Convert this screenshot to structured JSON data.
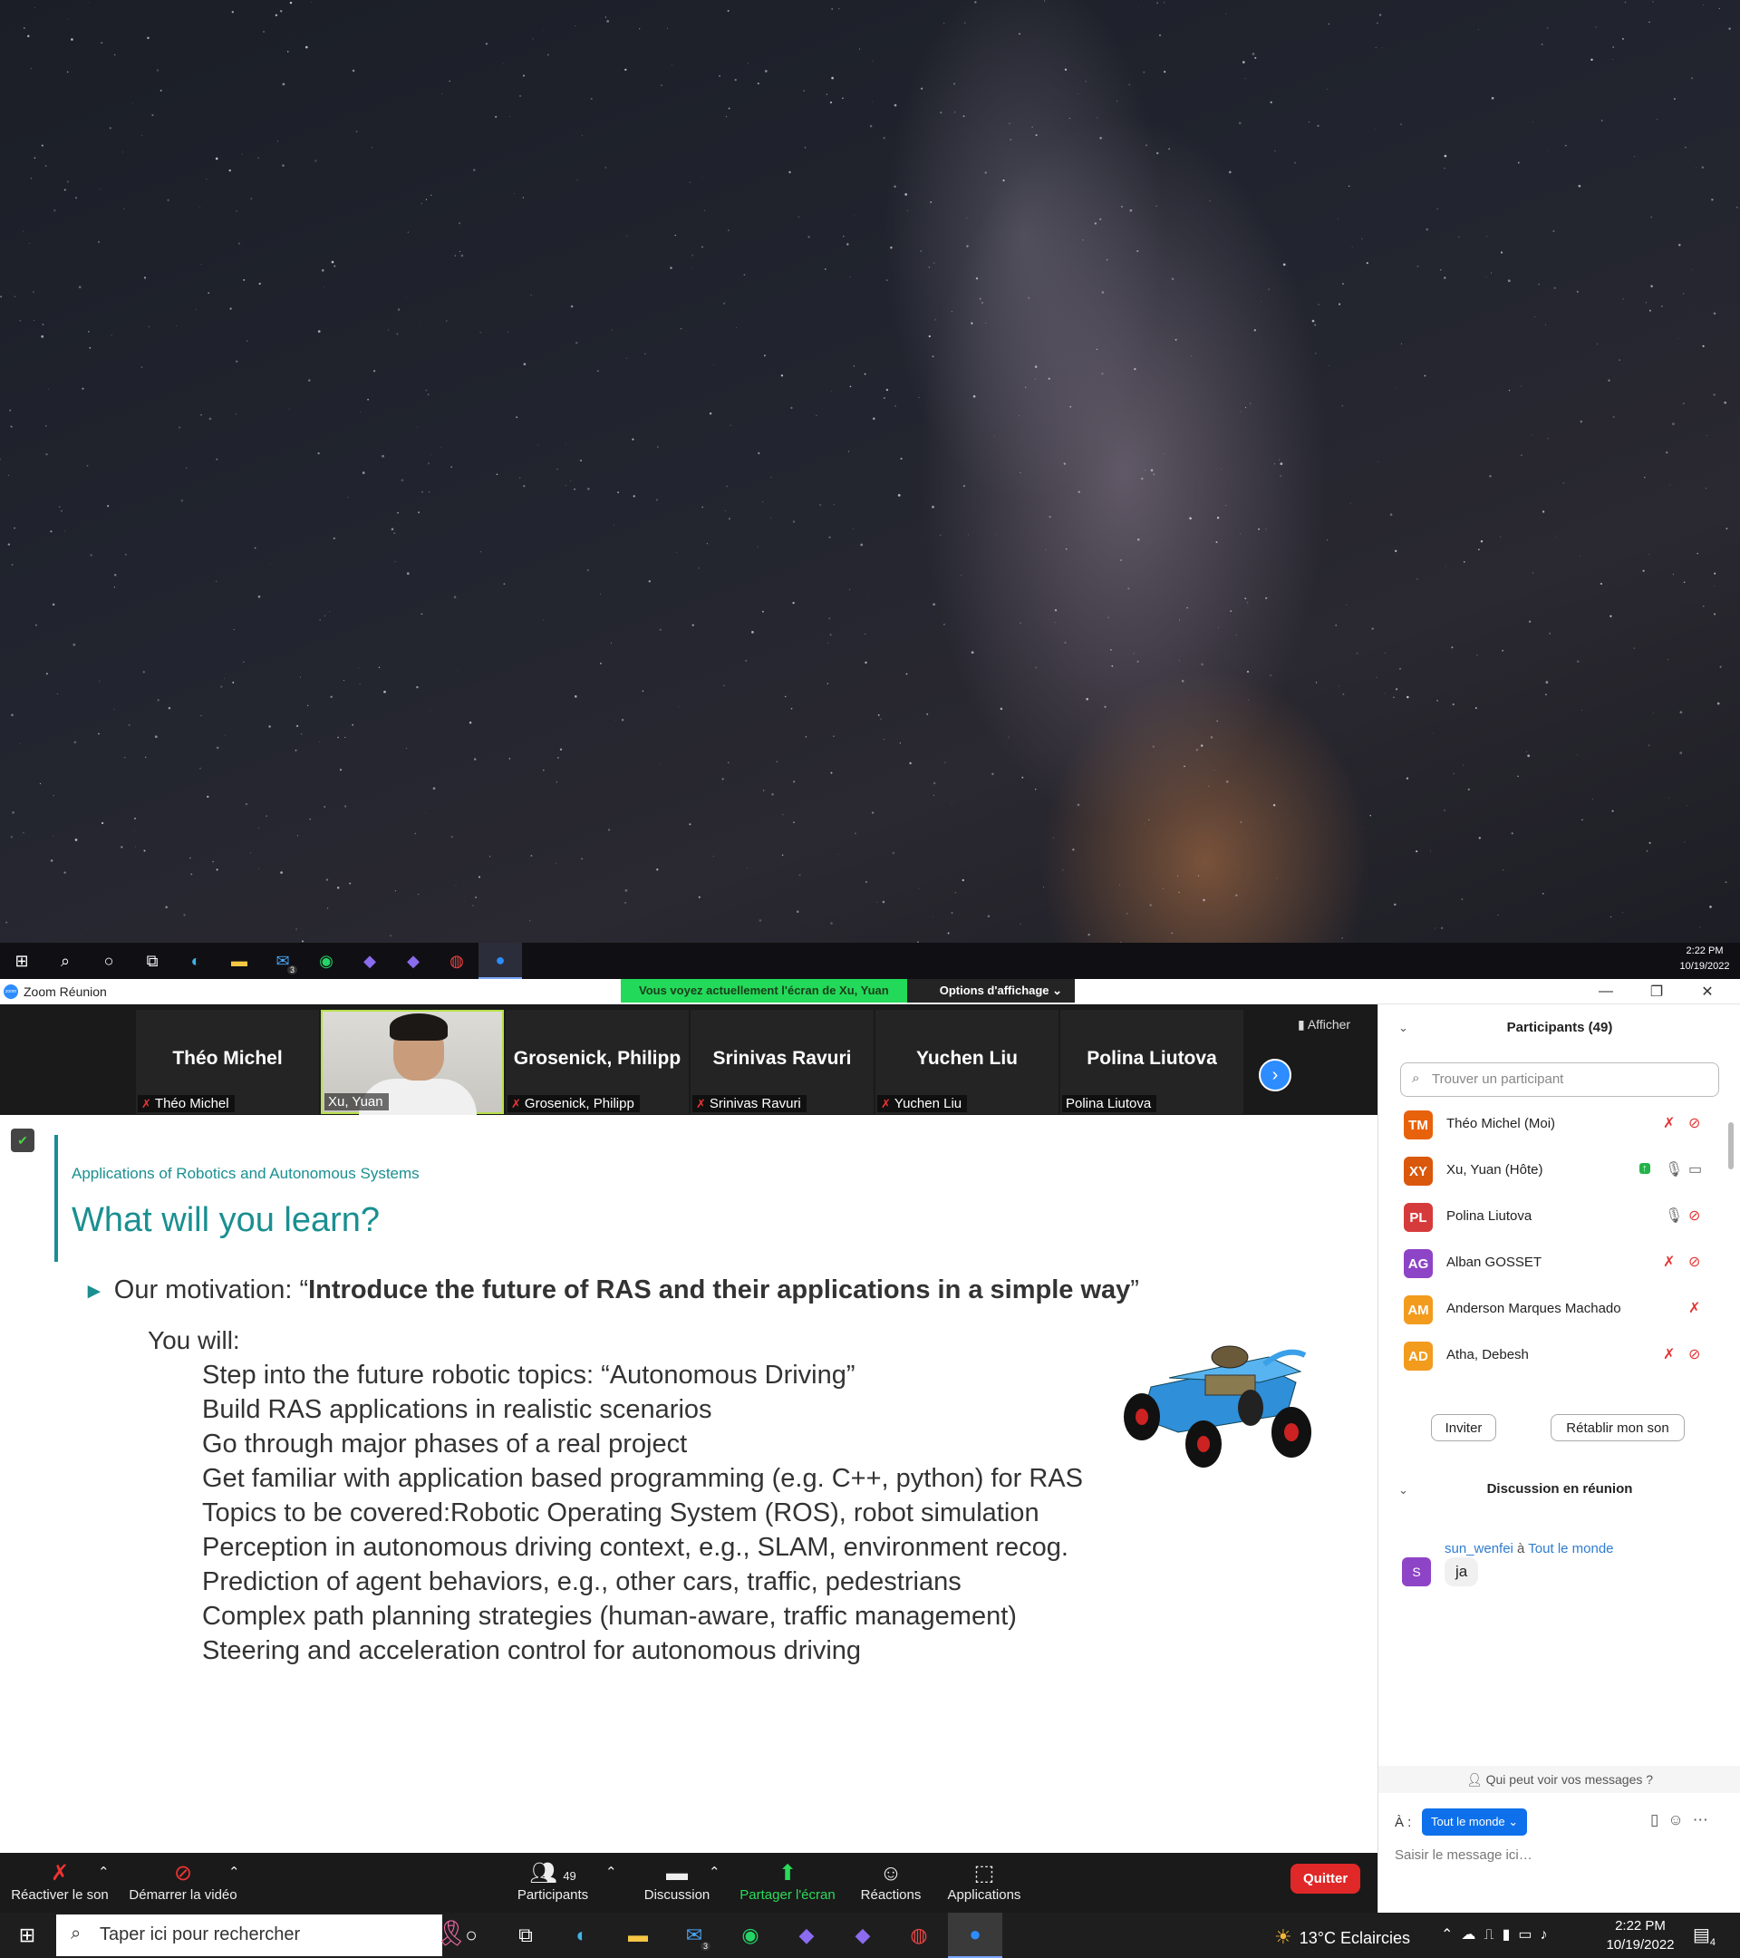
{
  "desktop": {
    "taskbar": {
      "icons": [
        "windows-start-icon",
        "search-icon",
        "cortana-icon",
        "task-view-icon",
        "edge-icon",
        "file-explorer-icon",
        "mail-icon",
        "whatsapp-icon",
        "obsidian-icon",
        "obsidian-icon",
        "chrome-icon",
        "zoom-icon"
      ],
      "mail_badge": "3",
      "time": "2:22 PM",
      "date": "10/19/2022"
    }
  },
  "zoom": {
    "window_title": "Zoom Réunion",
    "share_banner": "Vous voyez actuellement l'écran de Xu, Yuan",
    "view_options": "Options d'affichage",
    "afficher": "Afficher",
    "video_tiles": [
      {
        "big_name": "Théo Michel",
        "caption": "Théo Michel",
        "muted": true
      },
      {
        "big_name": "",
        "caption": "Xu, Yuan",
        "muted": false,
        "video": true
      },
      {
        "big_name": "Grosenick, Philipp",
        "caption": "Grosenick, Philipp",
        "muted": true
      },
      {
        "big_name": "Srinivas Ravuri",
        "caption": "Srinivas Ravuri",
        "muted": true
      },
      {
        "big_name": "Yuchen Liu",
        "caption": "Yuchen Liu",
        "muted": true
      },
      {
        "big_name": "Polina Liutova",
        "caption": "Polina Liutova",
        "muted": false
      }
    ],
    "slide": {
      "subtitle": "Applications of Robotics and Autonomous Systems",
      "title": "What will you learn?",
      "motivation_prefix": "Our motivation: “",
      "motivation_bold": "Introduce the future of RAS and their applications in a simple way",
      "motivation_suffix": "”",
      "you_will": "You will:",
      "bullets": [
        "Step into the future robotic topics: “Autonomous Driving”",
        "Build RAS applications in realistic scenarios",
        "Go through major phases of a real project",
        "Get familiar with application based programming (e.g. C++, python) for RAS",
        "Topics to be covered:Robotic Operating System (ROS), robot simulation",
        "Perception in autonomous driving context, e.g., SLAM, environment recog.",
        "Prediction of agent behaviors, e.g., other cars, traffic, pedestrians",
        "Complex path planning strategies (human-aware, traffic management)",
        "Steering and acceleration control for autonomous driving"
      ]
    },
    "participants_panel": {
      "title": "Participants (49)",
      "search_placeholder": "Trouver un participant",
      "participants": [
        {
          "initials": "TM",
          "name": "Théo Michel (Moi)",
          "color": "#e8620c",
          "mic": "muted",
          "video": "off"
        },
        {
          "initials": "XY",
          "name": "Xu, Yuan (Hôte)",
          "color": "#d9580b",
          "mic": "on",
          "video": "on",
          "sharing": true
        },
        {
          "initials": "PL",
          "name": "Polina Liutova",
          "color": "#d63b3b",
          "mic": "on",
          "video": "off"
        },
        {
          "initials": "AG",
          "name": "Alban GOSSET",
          "color": "#8e44c6",
          "mic": "muted",
          "video": "off"
        },
        {
          "initials": "AM",
          "name": "Anderson Marques Machado",
          "color": "#f29b1d",
          "mic": "muted",
          "video": "none"
        },
        {
          "initials": "AD",
          "name": "Atha, Debesh",
          "color": "#f29b1d",
          "mic": "muted",
          "video": "off"
        }
      ],
      "invite_label": "Inviter",
      "restore_sound_label": "Rétablir mon son"
    },
    "chat_panel": {
      "title": "Discussion en réunion",
      "messages": [
        {
          "sender": "sun_wenfei",
          "recipient_sep": " à ",
          "recipient": "Tout le monde",
          "avatar": "S",
          "text": "ja"
        }
      ],
      "who_can_see": "Qui peut voir vos messages ?",
      "to_label": "À :",
      "to_value": "Tout le monde",
      "input_placeholder": "Saisir le message ici…"
    },
    "toolbar": {
      "unmute": "Réactiver le son",
      "start_video": "Démarrer la vidéo",
      "participants": "Participants",
      "participants_count": "49",
      "chat": "Discussion",
      "share": "Partager l'écran",
      "reactions": "Réactions",
      "apps": "Applications",
      "quit": "Quitter"
    }
  },
  "taskbar_bottom": {
    "search_placeholder": "Taper ici pour rechercher",
    "mail_badge": "3",
    "weather": "13°C  Eclaircies",
    "time": "2:22 PM",
    "date": "10/19/2022",
    "notifications": "4"
  }
}
